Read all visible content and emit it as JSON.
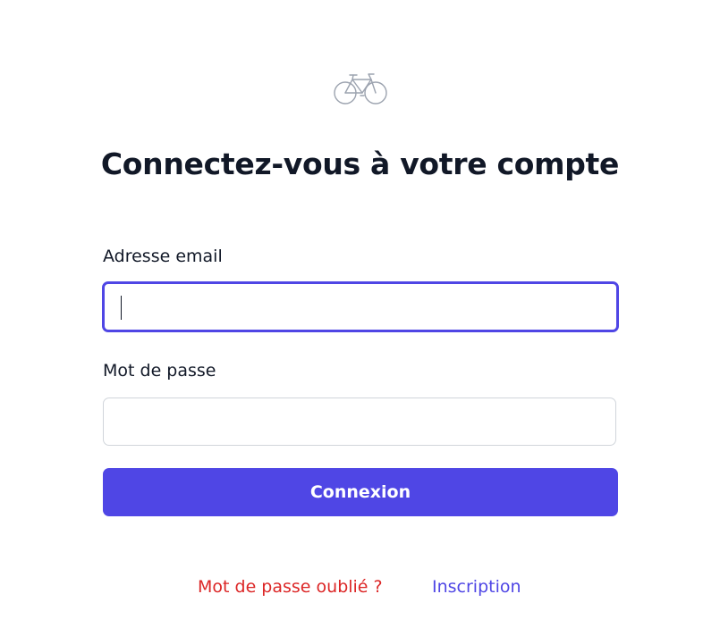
{
  "logo": {
    "icon": "bicycle-icon"
  },
  "title": "Connectez-vous à votre compte",
  "form": {
    "email_label": "Adresse email",
    "email_value": "",
    "password_label": "Mot de passe",
    "password_value": "",
    "submit_label": "Connexion"
  },
  "links": {
    "forgot_password": "Mot de passe oublié ?",
    "signup": "Inscription"
  },
  "colors": {
    "accent": "#4f46e5",
    "danger": "#dc2626",
    "text": "#111827",
    "border": "#d1d5db"
  }
}
